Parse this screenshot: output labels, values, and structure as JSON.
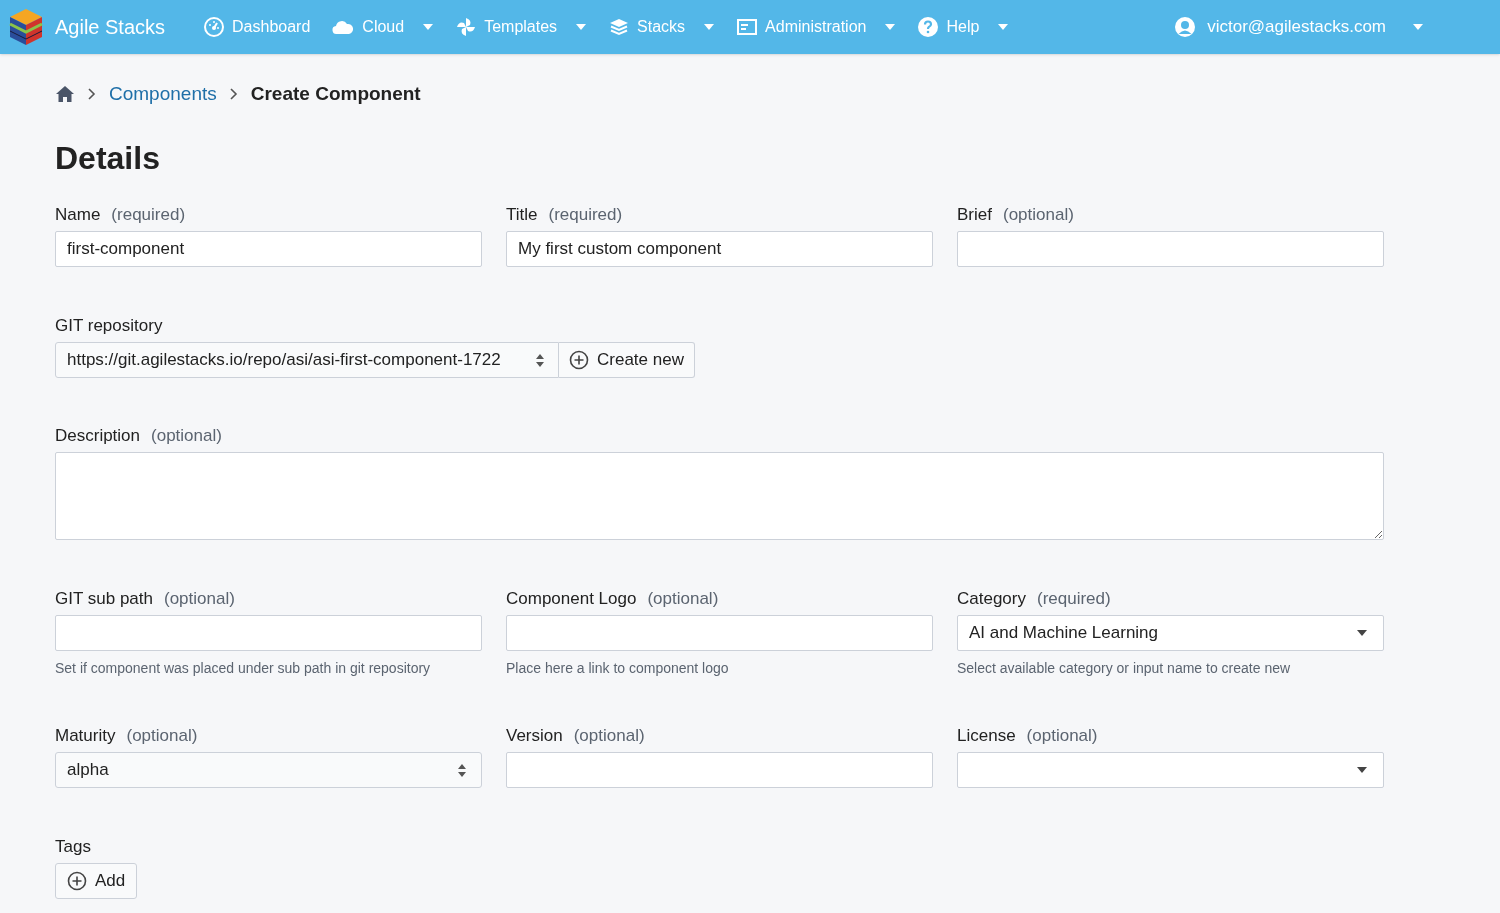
{
  "navbar": {
    "brand": "Agile Stacks",
    "items": [
      {
        "label": "Dashboard",
        "has_menu": false
      },
      {
        "label": "Cloud",
        "has_menu": true
      },
      {
        "label": "Templates",
        "has_menu": true
      },
      {
        "label": "Stacks",
        "has_menu": true
      },
      {
        "label": "Administration",
        "has_menu": true
      },
      {
        "label": "Help",
        "has_menu": true
      }
    ],
    "user": {
      "label": "victor@agilestacks.com",
      "has_menu": true
    }
  },
  "breadcrumb": [
    {
      "label": "Components",
      "kind": "link"
    },
    {
      "label": "Create Component",
      "kind": "current"
    }
  ],
  "heading": "Details",
  "rows": [
    [
      {
        "kind": "text",
        "label": "Name",
        "qualifier": "(required)",
        "value": "first-component"
      },
      {
        "kind": "text",
        "label": "Title",
        "qualifier": "(required)",
        "value": "My first custom component"
      },
      {
        "kind": "text",
        "label": "Brief",
        "qualifier": "(optional)"
      }
    ],
    [
      {
        "kind": "repo",
        "label": "GIT repository",
        "value": "https://git.agilestacks.io/repo/asi/asi-first-component-1722",
        "button": "Create new"
      }
    ],
    [
      {
        "kind": "textarea",
        "label": "Description",
        "qualifier": "(optional)"
      }
    ],
    [
      {
        "kind": "text",
        "label": "GIT sub path",
        "qualifier": "(optional)",
        "hint": "Set if component was placed under sub path in git repository"
      },
      {
        "kind": "text",
        "label": "Component Logo",
        "qualifier": "(optional)",
        "hint": "Place here a link to component logo"
      },
      {
        "kind": "select",
        "label": "Category",
        "qualifier": "(required)",
        "value": "AI and Machine Learning",
        "hint": "Select available category or input name to create new"
      }
    ],
    [
      {
        "kind": "native-select",
        "label": "Maturity",
        "qualifier": "(optional)",
        "value": "alpha"
      },
      {
        "kind": "text",
        "label": "Version",
        "qualifier": "(optional)"
      },
      {
        "kind": "select",
        "label": "License",
        "qualifier": "(optional)"
      }
    ],
    [
      {
        "kind": "tags",
        "label": "Tags",
        "button": "Add"
      }
    ]
  ]
}
